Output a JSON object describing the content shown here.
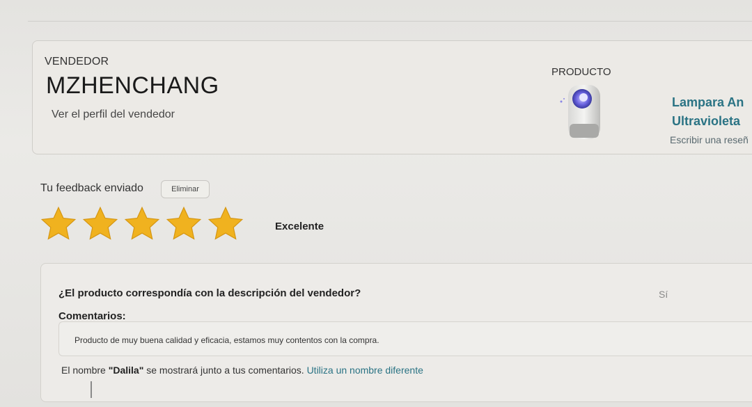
{
  "seller": {
    "heading": "VENDEDOR",
    "name": "MZHENCHANG",
    "profile_link": "Ver el perfil del vendedor"
  },
  "product": {
    "heading": "PRODUCTO",
    "title_line1": "Lampara An",
    "title_line2": "Ultravioleta",
    "review_link": "Escribir una reseñ",
    "image_icon": "uv-lamp-product-image"
  },
  "feedback": {
    "label": "Tu feedback enviado",
    "delete_label": "Eliminar",
    "rating": 5,
    "rating_max": 5,
    "rating_label": "Excelente",
    "star_color": "#f0b21f"
  },
  "details": {
    "question": "¿El producto correspondía con la descripción del vendedor?",
    "answer": "Sí",
    "comments_label": "Comentarios:",
    "comment_text": "Producto de muy buena calidad y eficacia, estamos muy contentos con la compra.",
    "name_note_prefix": "El nombre ",
    "name_value": "\"Dalila\"",
    "name_note_suffix": " se mostrará junto a tus comentarios. ",
    "name_change_link": "Utiliza un nombre diferente"
  }
}
